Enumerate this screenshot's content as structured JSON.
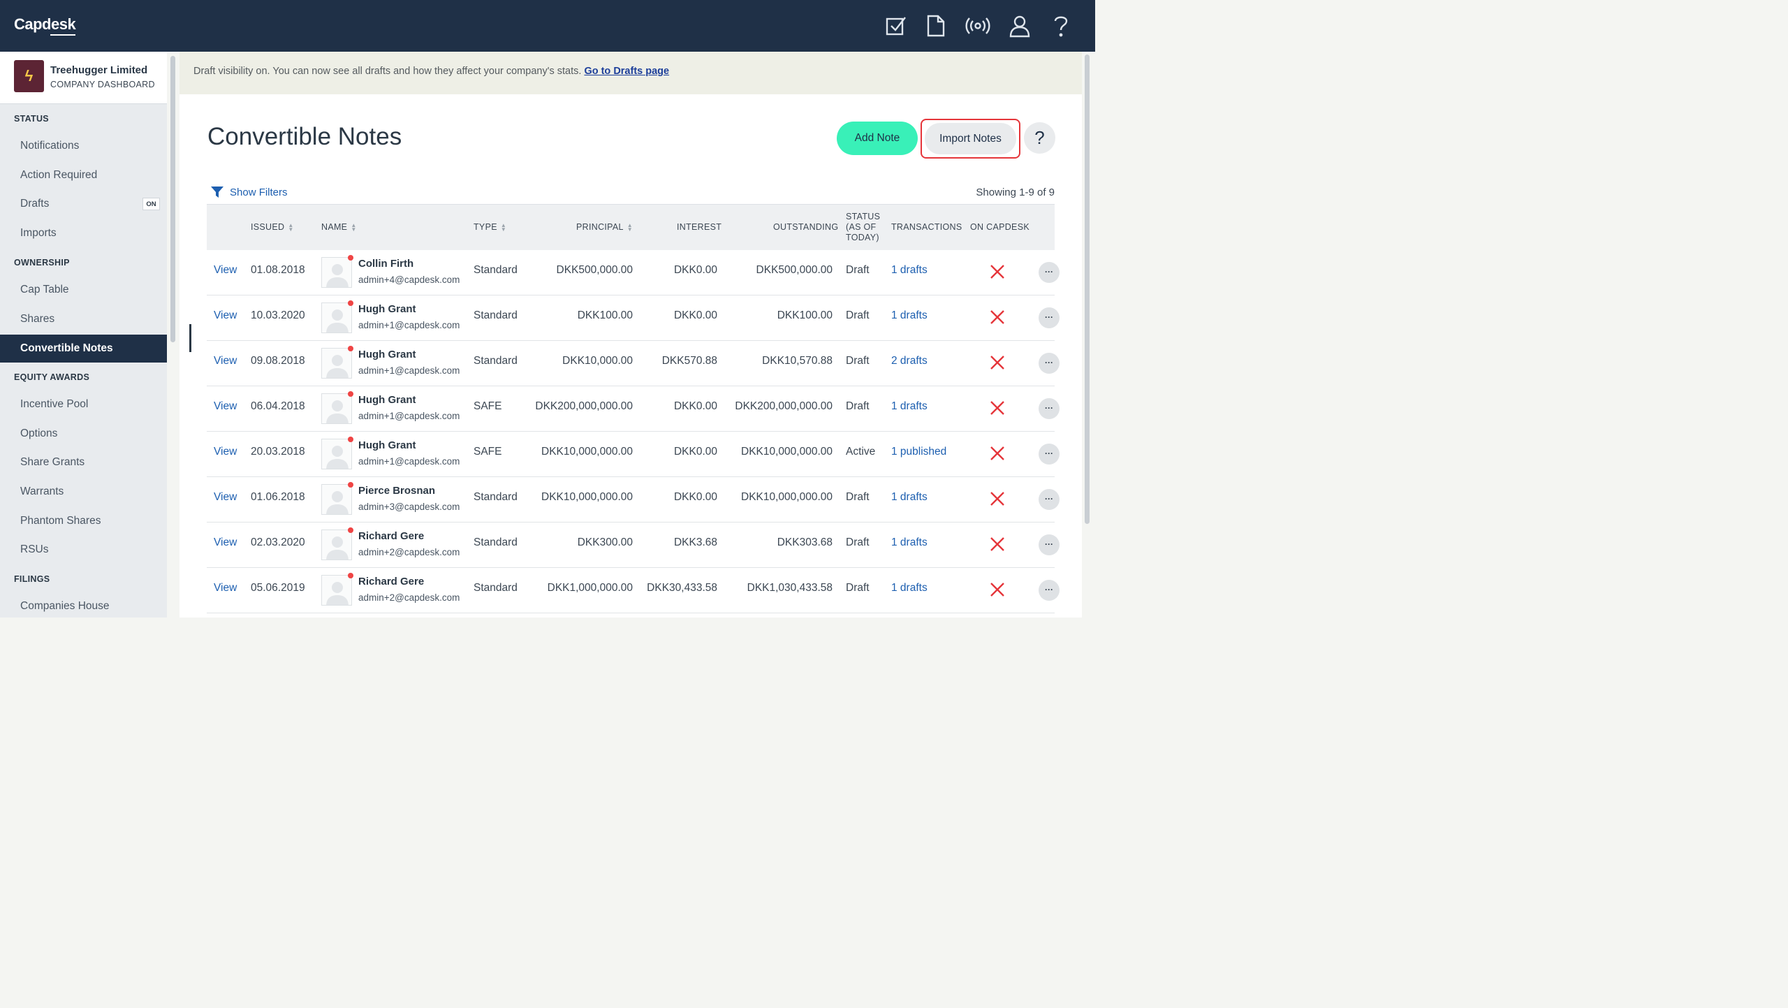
{
  "app": {
    "logo": "Capdesk"
  },
  "topbar": {
    "icons": [
      "tasks-checkbox-icon",
      "document-icon",
      "broadcast-icon",
      "user-icon",
      "help-icon"
    ]
  },
  "company": {
    "name": "Treehugger Limited",
    "subtitle": "COMPANY DASHBOARD",
    "logo_glyph": "ϟ"
  },
  "sidebar": {
    "sections": [
      {
        "title": "STATUS",
        "items": [
          "Notifications",
          "Action Required",
          "Drafts",
          "Imports"
        ]
      },
      {
        "title": "OWNERSHIP",
        "items": [
          "Cap Table",
          "Shares",
          "Convertible Notes"
        ]
      },
      {
        "title": "EQUITY AWARDS",
        "items": [
          "Incentive Pool",
          "Options",
          "Share Grants",
          "Warrants",
          "Phantom Shares",
          "RSUs"
        ]
      },
      {
        "title": "FILINGS",
        "items": [
          "Companies House"
        ]
      }
    ],
    "drafts_badge": "ON",
    "active_item": "Convertible Notes"
  },
  "banner": {
    "text": "Draft visibility on. You can now see all drafts and how they affect your company's stats.",
    "link": "Go to Drafts page"
  },
  "page": {
    "title": "Convertible Notes",
    "add_button": "Add Note",
    "import_button": "Import Notes",
    "help_button": "?",
    "show_filters": "Show Filters",
    "showing": "Showing 1-9 of 9"
  },
  "table": {
    "headers": {
      "issued": "ISSUED",
      "name": "NAME",
      "type": "TYPE",
      "principal": "PRINCIPAL",
      "interest": "INTEREST",
      "outstanding": "OUTSTANDING",
      "status_1": "STATUS",
      "status_2": "(AS OF",
      "status_3": "TODAY)",
      "transactions": "TRANSACTIONS",
      "on_capdesk": "ON CAPDESK"
    },
    "view_label": "View",
    "more_label": "···",
    "rows": [
      {
        "issued": "01.08.2018",
        "name": "Collin Firth",
        "email": "admin+4@capdesk.com",
        "type": "Standard",
        "principal": "DKK500,000.00",
        "interest": "DKK0.00",
        "outstanding": "DKK500,000.00",
        "status": "Draft",
        "transactions": "1 drafts"
      },
      {
        "issued": "10.03.2020",
        "name": "Hugh Grant",
        "email": "admin+1@capdesk.com",
        "type": "Standard",
        "principal": "DKK100.00",
        "interest": "DKK0.00",
        "outstanding": "DKK100.00",
        "status": "Draft",
        "transactions": "1 drafts"
      },
      {
        "issued": "09.08.2018",
        "name": "Hugh Grant",
        "email": "admin+1@capdesk.com",
        "type": "Standard",
        "principal": "DKK10,000.00",
        "interest": "DKK570.88",
        "outstanding": "DKK10,570.88",
        "status": "Draft",
        "transactions": "2 drafts"
      },
      {
        "issued": "06.04.2018",
        "name": "Hugh Grant",
        "email": "admin+1@capdesk.com",
        "type": "SAFE",
        "principal": "DKK200,000,000.00",
        "interest": "DKK0.00",
        "outstanding": "DKK200,000,000.00",
        "status": "Draft",
        "transactions": "1 drafts"
      },
      {
        "issued": "20.03.2018",
        "name": "Hugh Grant",
        "email": "admin+1@capdesk.com",
        "type": "SAFE",
        "principal": "DKK10,000,000.00",
        "interest": "DKK0.00",
        "outstanding": "DKK10,000,000.00",
        "status": "Active",
        "transactions": "1 published"
      },
      {
        "issued": "01.06.2018",
        "name": "Pierce Brosnan",
        "email": "admin+3@capdesk.com",
        "type": "Standard",
        "principal": "DKK10,000,000.00",
        "interest": "DKK0.00",
        "outstanding": "DKK10,000,000.00",
        "status": "Draft",
        "transactions": "1 drafts"
      },
      {
        "issued": "02.03.2020",
        "name": "Richard Gere",
        "email": "admin+2@capdesk.com",
        "type": "Standard",
        "principal": "DKK300.00",
        "interest": "DKK3.68",
        "outstanding": "DKK303.68",
        "status": "Draft",
        "transactions": "1 drafts"
      },
      {
        "issued": "05.06.2019",
        "name": "Richard Gere",
        "email": "admin+2@capdesk.com",
        "type": "Standard",
        "principal": "DKK1,000,000.00",
        "interest": "DKK30,433.58",
        "outstanding": "DKK1,030,433.58",
        "status": "Draft",
        "transactions": "1 drafts"
      }
    ]
  },
  "colors": {
    "navy": "#1f3047",
    "accent_green": "#39f0b8",
    "link_blue": "#1d5fb0",
    "red_x": "#e5353a"
  }
}
